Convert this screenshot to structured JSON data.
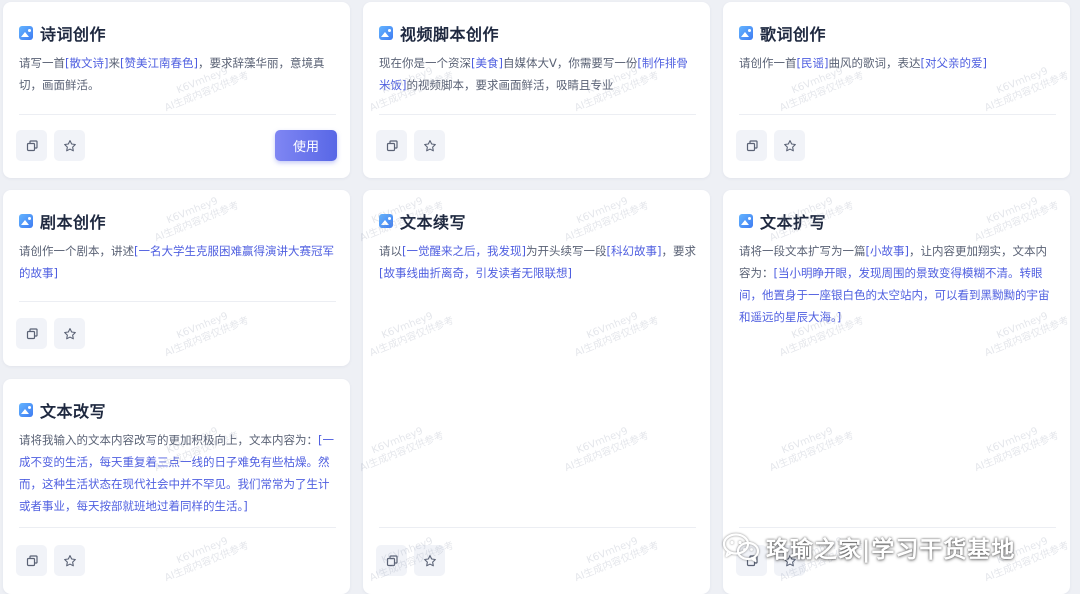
{
  "cards": [
    {
      "title": "诗词创作",
      "desc": [
        {
          "t": "请写一首"
        },
        {
          "t": "[散文诗]",
          "h": true
        },
        {
          "t": "来"
        },
        {
          "t": "[赞美江南春色]",
          "h": true
        },
        {
          "t": "，要求辞藻华丽，意境真切，画面鲜活。"
        }
      ],
      "use_label": "使用"
    },
    {
      "title": "视频脚本创作",
      "desc": [
        {
          "t": "现在你是一个资深"
        },
        {
          "t": "[美食]",
          "h": true
        },
        {
          "t": "自媒体大V，你需要写一份"
        },
        {
          "t": "[制作排骨米饭]",
          "h": true
        },
        {
          "t": "的视频脚本，要求画面鲜活，吸睛且专业"
        }
      ]
    },
    {
      "title": "歌词创作",
      "desc": [
        {
          "t": "请创作一首"
        },
        {
          "t": "[民谣]",
          "h": true
        },
        {
          "t": "曲风的歌词，表达"
        },
        {
          "t": "[对父亲的爱]",
          "h": true
        }
      ]
    },
    {
      "title": "剧本创作",
      "desc": [
        {
          "t": "请创作一个剧本，讲述"
        },
        {
          "t": "[一名大学生克服困难赢得演讲大赛冠军的故事]",
          "h": true
        }
      ]
    },
    {
      "title": "文本续写",
      "desc": [
        {
          "t": "请以"
        },
        {
          "t": "[一觉醒来之后，我发现]",
          "h": true
        },
        {
          "t": "为开头续写一段"
        },
        {
          "t": "[科幻故事]",
          "h": true
        },
        {
          "t": "，要求"
        },
        {
          "t": "[故事线曲折离奇，引发读者无限联想]",
          "h": true
        }
      ]
    },
    {
      "title": "文本扩写",
      "desc": [
        {
          "t": "请将一段文本扩写为一篇"
        },
        {
          "t": "[小故事]",
          "h": true
        },
        {
          "t": "，让内容更加翔实，文本内容为："
        },
        {
          "t": "[当小明睁开眼，发现周围的景致变得模糊不清。转眼间，他置身于一座银白色的太空站内，可以看到黑黝黝的宇宙和遥远的星辰大海。]",
          "h": true
        }
      ]
    },
    {
      "title": "文本改写",
      "desc": [
        {
          "t": "请将我输入的文本内容改写的更加积极向上，文本内容为："
        },
        {
          "t": "[一成不变的生活，每天重复着三点一线的日子难免有些枯燥。然而，这种生活状态在现代社会中并不罕见。我们常常为了生计或者事业，每天按部就班地过着同样的生活。]",
          "h": true
        }
      ]
    }
  ],
  "watermark": {
    "line1": "K6Vmhey9",
    "line2": "AI生成内容仅供参考"
  },
  "brand": {
    "text": "珞瑜之家|学习干货基地",
    "icon": "wechat-icon"
  },
  "colors": {
    "highlight": "#4f5fe0",
    "accent": "#5867e6",
    "title": "#1f2940"
  }
}
